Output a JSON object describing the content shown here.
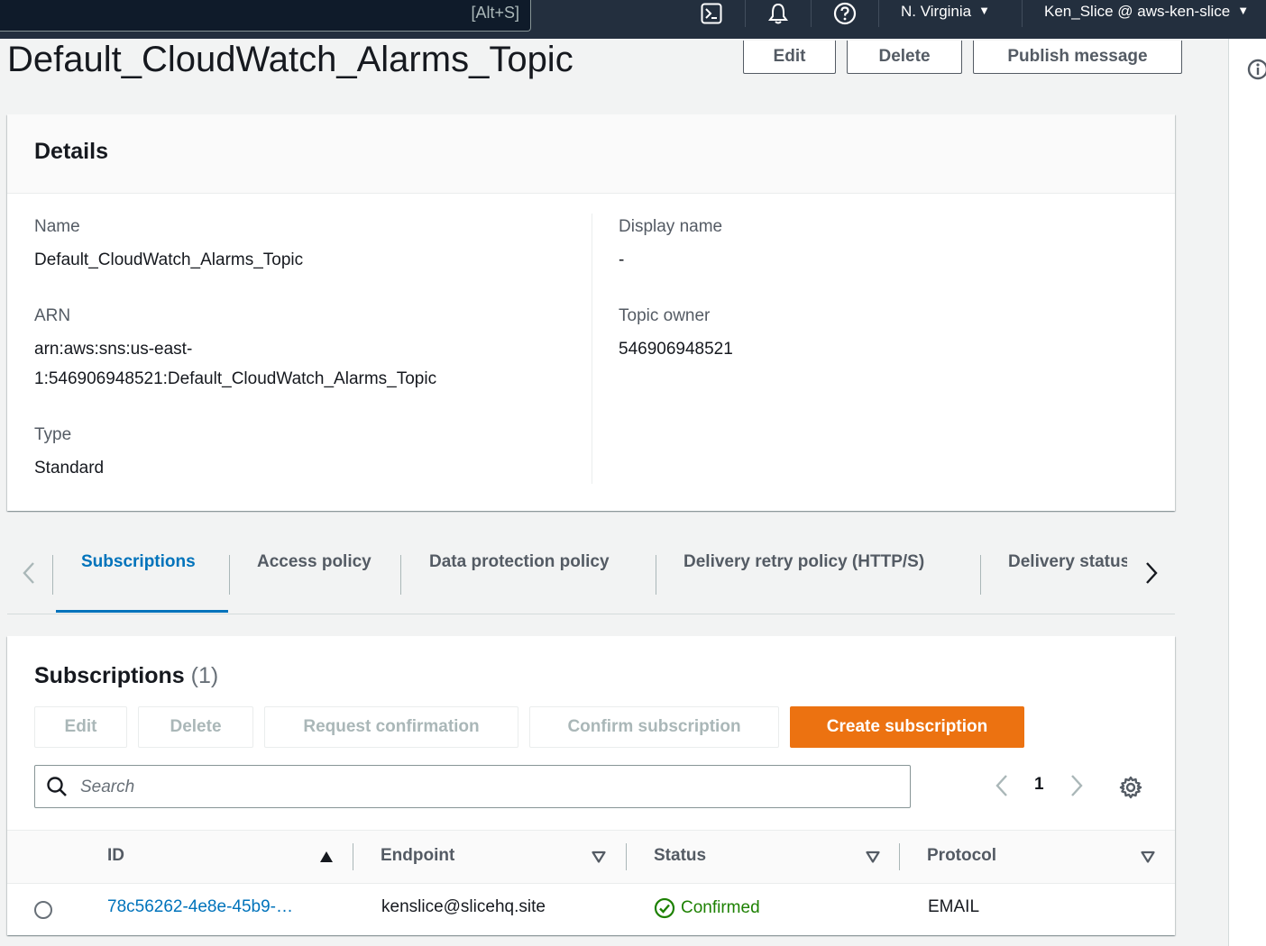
{
  "topnav": {
    "search_shortcut": "[Alt+S]",
    "region": "N. Virginia",
    "account": "Ken_Slice @ aws-ken-slice"
  },
  "header": {
    "title": "Default_CloudWatch_Alarms_Topic",
    "edit_label": "Edit",
    "delete_label": "Delete",
    "publish_label": "Publish message"
  },
  "details": {
    "title": "Details",
    "name_label": "Name",
    "name_value": "Default_CloudWatch_Alarms_Topic",
    "arn_label": "ARN",
    "arn_line1": "arn:aws:sns:us-east-",
    "arn_line2": "1:546906948521:Default_CloudWatch_Alarms_Topic",
    "type_label": "Type",
    "type_value": "Standard",
    "display_name_label": "Display name",
    "display_name_value": "-",
    "owner_label": "Topic owner",
    "owner_value": "546906948521"
  },
  "tabs": [
    {
      "label": "Subscriptions",
      "active": true
    },
    {
      "label": "Access policy"
    },
    {
      "label": "Data protection policy"
    },
    {
      "label": "Delivery retry policy (HTTP/S)"
    },
    {
      "label": "Delivery status logging"
    }
  ],
  "subscriptions": {
    "title": "Subscriptions",
    "count": "(1)",
    "buttons": {
      "edit": "Edit",
      "delete": "Delete",
      "request_confirmation": "Request confirmation",
      "confirm_subscription": "Confirm subscription",
      "create_subscription": "Create subscription"
    },
    "search_placeholder": "Search",
    "page": "1",
    "columns": [
      "ID",
      "Endpoint",
      "Status",
      "Protocol"
    ],
    "rows": [
      {
        "id": "78c56262-4e8e-45b9-…",
        "endpoint": "kenslice@slicehq.site",
        "status": "Confirmed",
        "protocol": "EMAIL"
      }
    ]
  },
  "colors": {
    "nav_bg": "#232f3e",
    "link": "#0073bb",
    "primary": "#ec7211",
    "success": "#1d8102"
  }
}
